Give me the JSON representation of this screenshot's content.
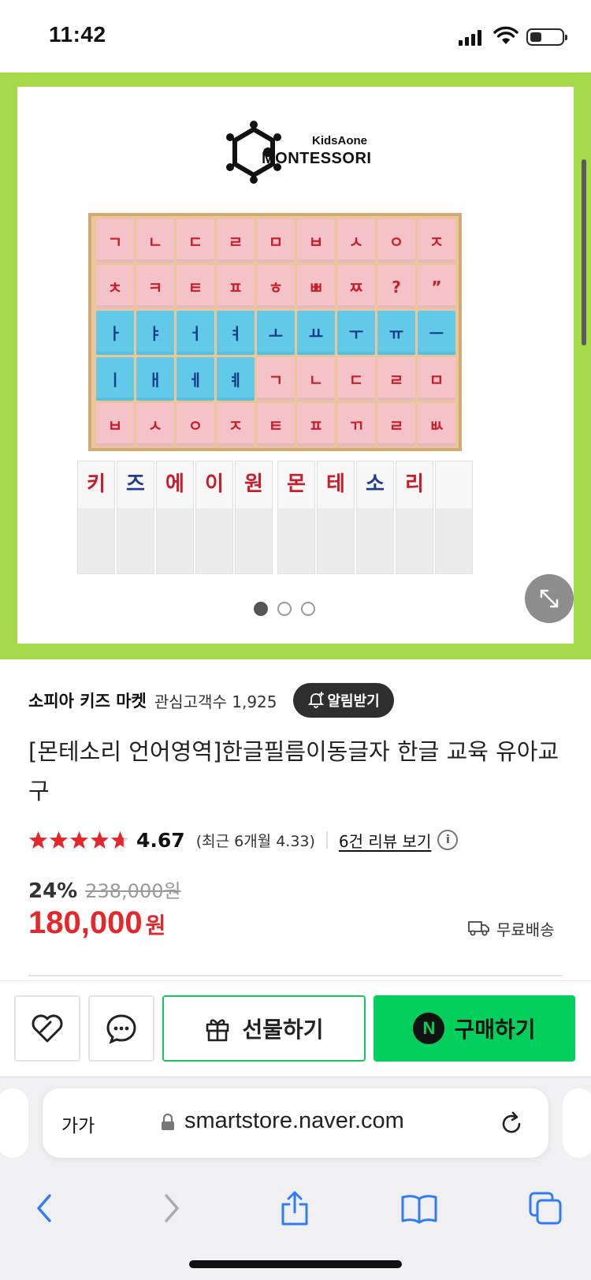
{
  "status_bar": {
    "time": "11:42"
  },
  "product_image": {
    "brand_line1": "KidsAone",
    "brand_line2": "MONTESSORI",
    "tray_rows": [
      [
        "ㄱ",
        "ㄴ",
        "ㄷ",
        "ㄹ",
        "ㅁ",
        "ㅂ",
        "ㅅ",
        "ㅇ",
        "ㅈ"
      ],
      [
        "ㅊ",
        "ㅋ",
        "ㅌ",
        "ㅍ",
        "ㅎ",
        "ㅃ",
        "ㅉ",
        "?",
        "”"
      ],
      [
        "ㅏ",
        "ㅑ",
        "ㅓ",
        "ㅕ",
        "ㅗ",
        "ㅛ",
        "ㅜ",
        "ㅠ",
        "ㅡ"
      ],
      [
        "ㅣ",
        "ㅐ",
        "ㅔ",
        "ㅖ",
        "ㄱ",
        "ㄴ",
        "ㄷ",
        "ㄹ",
        "ㅁ"
      ],
      [
        "ㅂ",
        "ㅅ",
        "ㅇ",
        "ㅈ",
        "ㅌ",
        "ㅍ",
        "ㄲ",
        "ㄹ",
        "ㅄ"
      ]
    ],
    "tray_row_colors": [
      [
        "pink",
        "pink",
        "pink",
        "pink",
        "pink",
        "pink",
        "pink",
        "pink",
        "pink"
      ],
      [
        "pink",
        "pink",
        "pink",
        "pink",
        "pink",
        "pink",
        "pink",
        "pink",
        "pink"
      ],
      [
        "blue",
        "blue",
        "blue",
        "blue",
        "blue",
        "blue",
        "blue",
        "blue",
        "blue"
      ],
      [
        "blue",
        "blue",
        "blue",
        "blue",
        "pink",
        "pink",
        "pink",
        "pink",
        "pink"
      ],
      [
        "pink",
        "pink",
        "pink",
        "pink",
        "pink",
        "pink",
        "pink",
        "pink",
        "pink"
      ]
    ],
    "cards_group1": [
      {
        "text": "키",
        "color": "red"
      },
      {
        "text": "즈",
        "color": "blue"
      },
      {
        "text": "에",
        "color": "red"
      },
      {
        "text": "이",
        "color": "red"
      },
      {
        "text": "원",
        "color": "red"
      }
    ],
    "cards_group2": [
      {
        "text": "몬",
        "color": "red"
      },
      {
        "text": "테",
        "color": "red"
      },
      {
        "text": "소",
        "color": "blue"
      },
      {
        "text": "리",
        "color": "red"
      },
      {
        "text": "",
        "color": "red"
      }
    ],
    "carousel_total": 3,
    "carousel_active": 1
  },
  "store": {
    "name": "소피아 키즈 마켓",
    "fans_label": "관심고객수 1,925",
    "alarm_label": "알림받기"
  },
  "product": {
    "title": "[몬테소리 언어영역]한글필름이동글자 한글 교육 유아교구",
    "rating": "4.67",
    "rating_stars": 4.67,
    "recent_rating": "(최근 6개월 4.33)",
    "review_link": "6건 리뷰 보기",
    "discount": "24%",
    "original_price": "238,000원",
    "price": "180,000",
    "currency": "원",
    "shipping": "무료배송"
  },
  "actions": {
    "gift_label": "선물하기",
    "buy_label": "구매하기",
    "buy_badge": "N"
  },
  "browser": {
    "text_size_label": "가가",
    "url": "smartstore.naver.com"
  },
  "colors": {
    "banner_green": "#a6d94a",
    "price_red": "#e5262b",
    "naver_green": "#03cf5d",
    "ios_blue": "#2f7cf6"
  }
}
